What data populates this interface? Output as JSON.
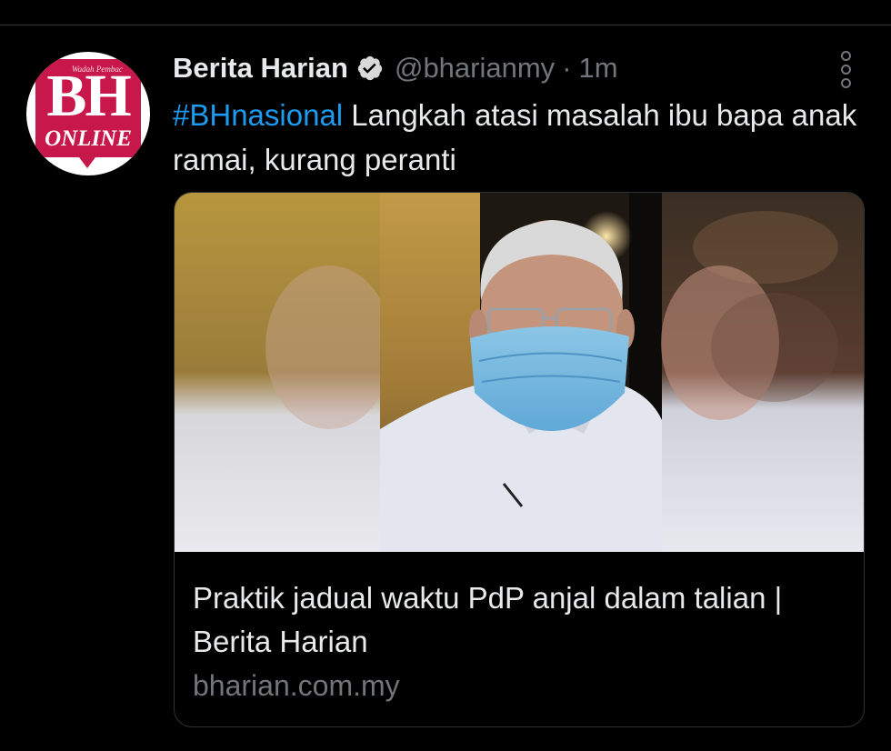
{
  "tweet": {
    "author_name": "Berita Harian",
    "handle": "@bharianmy",
    "separator": "·",
    "time": "1m",
    "hashtag": "#BHnasional",
    "text": " Langkah atasi masalah ibu bapa anak ramai, kurang peranti",
    "avatar": {
      "tagline": "Wadah Pembac",
      "letters": "BH",
      "word": "ONLINE"
    },
    "icons": {
      "verified": "verified-badge-icon",
      "more": "more-options-icon"
    }
  },
  "card": {
    "title": "Praktik jadual waktu PdP anjal dalam talian | Berita Harian",
    "domain": "bharian.com.my",
    "image_desc_icon": "article-thumbnail"
  },
  "colors": {
    "background": "#000000",
    "hashtag": "#1d9bf0",
    "brand": "#c8174a",
    "muted": "#71767b"
  }
}
